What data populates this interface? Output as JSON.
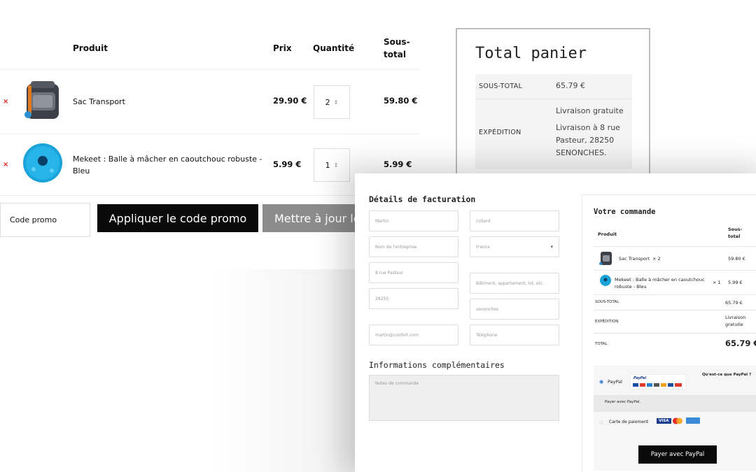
{
  "cart": {
    "headers": {
      "product": "Produit",
      "price": "Prix",
      "quantity": "Quantité",
      "subtotal": "Sous-\ntotal"
    },
    "items": [
      {
        "remove": "×",
        "name": "Sac Transport",
        "price": "29.90 €",
        "qty": "2",
        "subtotal": "59.80 €",
        "icon": "backpack-carrier-icon"
      },
      {
        "remove": "×",
        "name": "Mekeet : Balle à mâcher en caoutchouc robuste -\nBleu",
        "price": "5.99 €",
        "qty": "1",
        "subtotal": "5.99 €",
        "icon": "blue-ball-icon"
      }
    ],
    "coupon_placeholder": "Code promo",
    "apply_label": "Appliquer le code promo",
    "update_label": "Mettre à jour le panier"
  },
  "totals": {
    "title": "Total panier",
    "subtotal_label": "SOUS-TOTAL",
    "subtotal_value": "65.79 €",
    "shipping_label": "EXPÉDITION",
    "shipping_free": "Livraison gratuite",
    "shipping_address": "Livraison à 8 rue Pasteur, 28250 SENONCHES."
  },
  "billing": {
    "title": "Détails de facturation",
    "fields": {
      "first_name": "Martin",
      "last_name": "collard",
      "company": "Nom de l'entreprise",
      "country": "France",
      "street": "8 rue Pasteur",
      "apartment": "Bâtiment, appartement, lot, etc.",
      "postcode": "28250",
      "city": "senonches",
      "email": "martin@confort.com",
      "phone": "Téléphone"
    },
    "extra_title": "Informations complémentaires",
    "notes_placeholder": "Notes de commande"
  },
  "order": {
    "title": "Votre commande",
    "col_product": "Produit",
    "col_subtotal": "Sous-\ntotal",
    "lines": [
      {
        "name": "Sac Transport",
        "qty": "× 2",
        "total": "59.80 €"
      },
      {
        "name": "Mekeet : Balle à mâcher en caoutchouc\nrobuste - Bleu",
        "qty": "× 1",
        "total": "5.99 €"
      }
    ],
    "subtotal_label": "SOUS-TOTAL",
    "subtotal_value": "65.79 €",
    "shipping_label": "EXPÉDITION",
    "shipping_value": "Livraison\ngratuite",
    "total_label": "TOTAL",
    "total_value": "65.79 €"
  },
  "payment": {
    "paypal_label": "PayPal",
    "paypal_logo": "PayPal",
    "what_is_paypal": "Qu'est-ce que PayPal ?",
    "paypal_desc": "Payer avec PayPal.",
    "card_label": "Carte de paiement",
    "card_visa": "VISA",
    "pay_button": "Payer avec PayPal"
  },
  "colors": {
    "accent_dark": "#0a0a0a",
    "muted_button": "#8c8c8c",
    "remove_red": "#dd2222",
    "ball_blue": "#1aa3d9"
  }
}
